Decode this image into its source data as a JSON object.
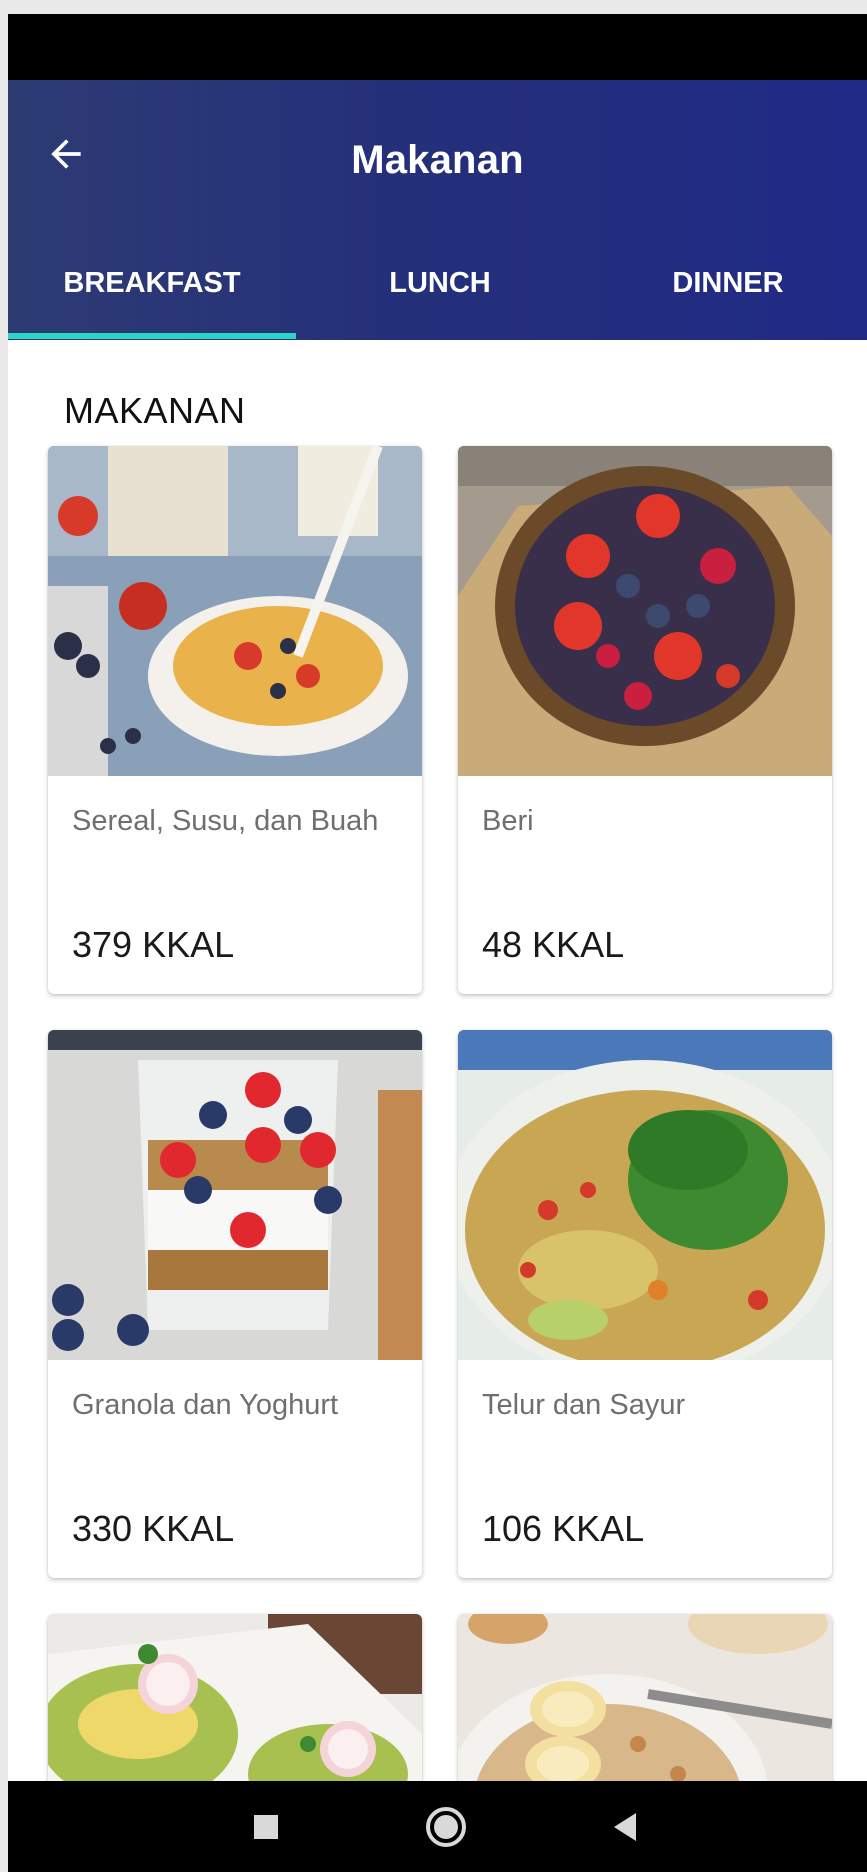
{
  "appbar": {
    "title": "Makanan",
    "back_icon": "arrow-left-icon",
    "background_from": "#2d3b73",
    "background_to": "#202a86"
  },
  "tabs": [
    {
      "label": "BREAKFAST",
      "selected": true
    },
    {
      "label": "LUNCH",
      "selected": false
    },
    {
      "label": "DINNER",
      "selected": false
    }
  ],
  "tab_indicator_color": "#2dd3c4",
  "section": {
    "title": "MAKANAN"
  },
  "foods": [
    {
      "name": "Sereal, Susu, dan Buah",
      "kcal": "379 KKAL",
      "image": "cereal-milk-fruit-photo"
    },
    {
      "name": "Beri",
      "kcal": "48 KKAL",
      "image": "berries-basket-photo"
    },
    {
      "name": "Granola dan Yoghurt",
      "kcal": "330 KKAL",
      "image": "granola-yoghurt-photo"
    },
    {
      "name": "Telur dan Sayur",
      "kcal": "106 KKAL",
      "image": "egg-vegetable-photo"
    },
    {
      "image": "avocado-toast-photo"
    },
    {
      "image": "oatmeal-banana-photo"
    }
  ],
  "system_nav": {
    "recents_icon": "square-icon",
    "home_icon": "circle-icon",
    "back_icon": "triangle-back-icon"
  }
}
